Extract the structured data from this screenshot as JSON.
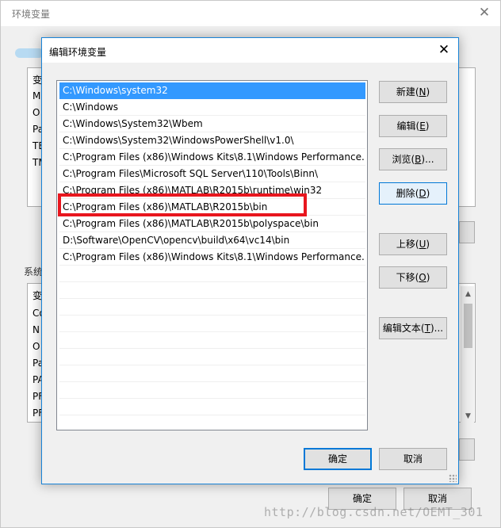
{
  "parent_window": {
    "title": "环境变量",
    "user_list_header": "变",
    "user_list_letters": [
      "M",
      "O",
      "Pa",
      "TE",
      "TM"
    ],
    "system_section_label": "系统",
    "system_list_header": "变",
    "system_list_letters": [
      "Co",
      "N",
      "O",
      "Pa",
      "PA",
      "PF",
      "PF"
    ],
    "ok_label": "确定",
    "cancel_label": "取消"
  },
  "watermark": "http://blog.csdn.net/OEMT_301",
  "dialog": {
    "title": "编辑环境变量",
    "paths": [
      "C:\\Windows\\system32",
      "C:\\Windows",
      "C:\\Windows\\System32\\Wbem",
      "C:\\Windows\\System32\\WindowsPowerShell\\v1.0\\",
      "C:\\Program Files (x86)\\Windows Kits\\8.1\\Windows Performance...",
      "C:\\Program Files\\Microsoft SQL Server\\110\\Tools\\Binn\\",
      "C:\\Program Files (x86)\\MATLAB\\R2015b\\runtime\\win32",
      "C:\\Program Files (x86)\\MATLAB\\R2015b\\bin",
      "C:\\Program Files (x86)\\MATLAB\\R2015b\\polyspace\\bin",
      "D:\\Software\\OpenCV\\opencv\\build\\x64\\vc14\\bin",
      "C:\\Program Files (x86)\\Windows Kits\\8.1\\Windows Performance..."
    ],
    "selected_index": 0,
    "highlighted_index": 7,
    "buttons": {
      "new": {
        "label": "新建",
        "key": "N"
      },
      "edit": {
        "label": "编辑",
        "key": "E"
      },
      "browse": {
        "label": "浏览",
        "key": "B",
        "suffix": "..."
      },
      "delete": {
        "label": "删除",
        "key": "D"
      },
      "up": {
        "label": "上移",
        "key": "U"
      },
      "down": {
        "label": "下移",
        "key": "O"
      },
      "edit_text": {
        "label": "编辑文本",
        "key": "T",
        "suffix": "..."
      }
    },
    "ok_label": "确定",
    "cancel_label": "取消"
  }
}
